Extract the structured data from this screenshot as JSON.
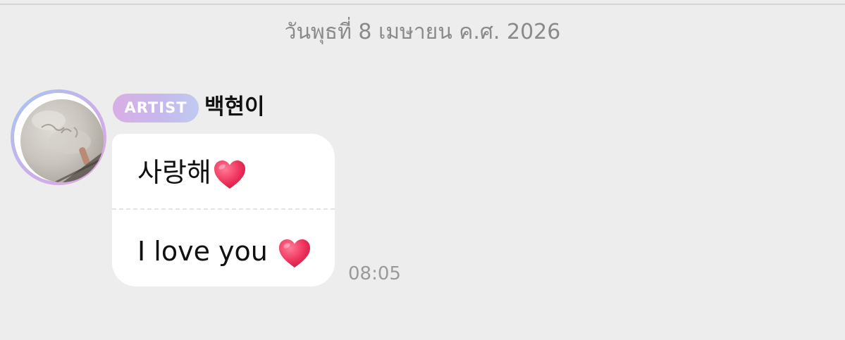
{
  "date_separator": "วันพุธที่ 8 เมษายน ค.ศ. 2026",
  "message": {
    "badge": "ARTIST",
    "sender": "백현이",
    "lines": [
      {
        "text": "사랑해",
        "emoji": "heart-icon"
      },
      {
        "text": "I love you ",
        "emoji": "heart-icon"
      }
    ],
    "time": "08:05"
  },
  "colors": {
    "background": "#ededed",
    "bubble": "#ffffff",
    "heart": "#f0365e",
    "badge_gradient_start": "#d9aee4",
    "badge_gradient_end": "#bfcaf0"
  }
}
